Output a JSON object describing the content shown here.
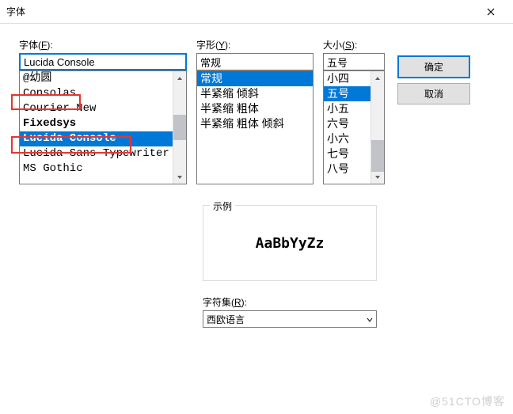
{
  "window": {
    "title": "字体",
    "close_icon": "×"
  },
  "font": {
    "label_pre": "字体(",
    "label_key": "F",
    "label_post": "):",
    "input_value": "Lucida Console",
    "items": [
      "@幼圆",
      "Consolas",
      "Courier New",
      "Fixedsys",
      "Lucida Console",
      "Lucida Sans Typewriter",
      "MS Gothic"
    ],
    "selected_index": 4
  },
  "style": {
    "label_pre": "字形(",
    "label_key": "Y",
    "label_post": "):",
    "input_value": "常规",
    "items": [
      "常规",
      "半紧缩 倾斜",
      "半紧缩 粗体",
      "半紧缩 粗体 倾斜"
    ],
    "selected_index": 0
  },
  "size": {
    "label_pre": "大小(",
    "label_key": "S",
    "label_post": "):",
    "input_value": "五号",
    "items": [
      "小四",
      "五号",
      "小五",
      "六号",
      "小六",
      "七号",
      "八号"
    ],
    "selected_index": 1
  },
  "buttons": {
    "ok": "确定",
    "cancel": "取消"
  },
  "sample": {
    "label": "示例",
    "text": "AaBbYyZz"
  },
  "charset": {
    "label_pre": "字符集(",
    "label_key": "R",
    "label_post": "):",
    "value": "西欧语言"
  },
  "watermark": "@51CTO博客"
}
